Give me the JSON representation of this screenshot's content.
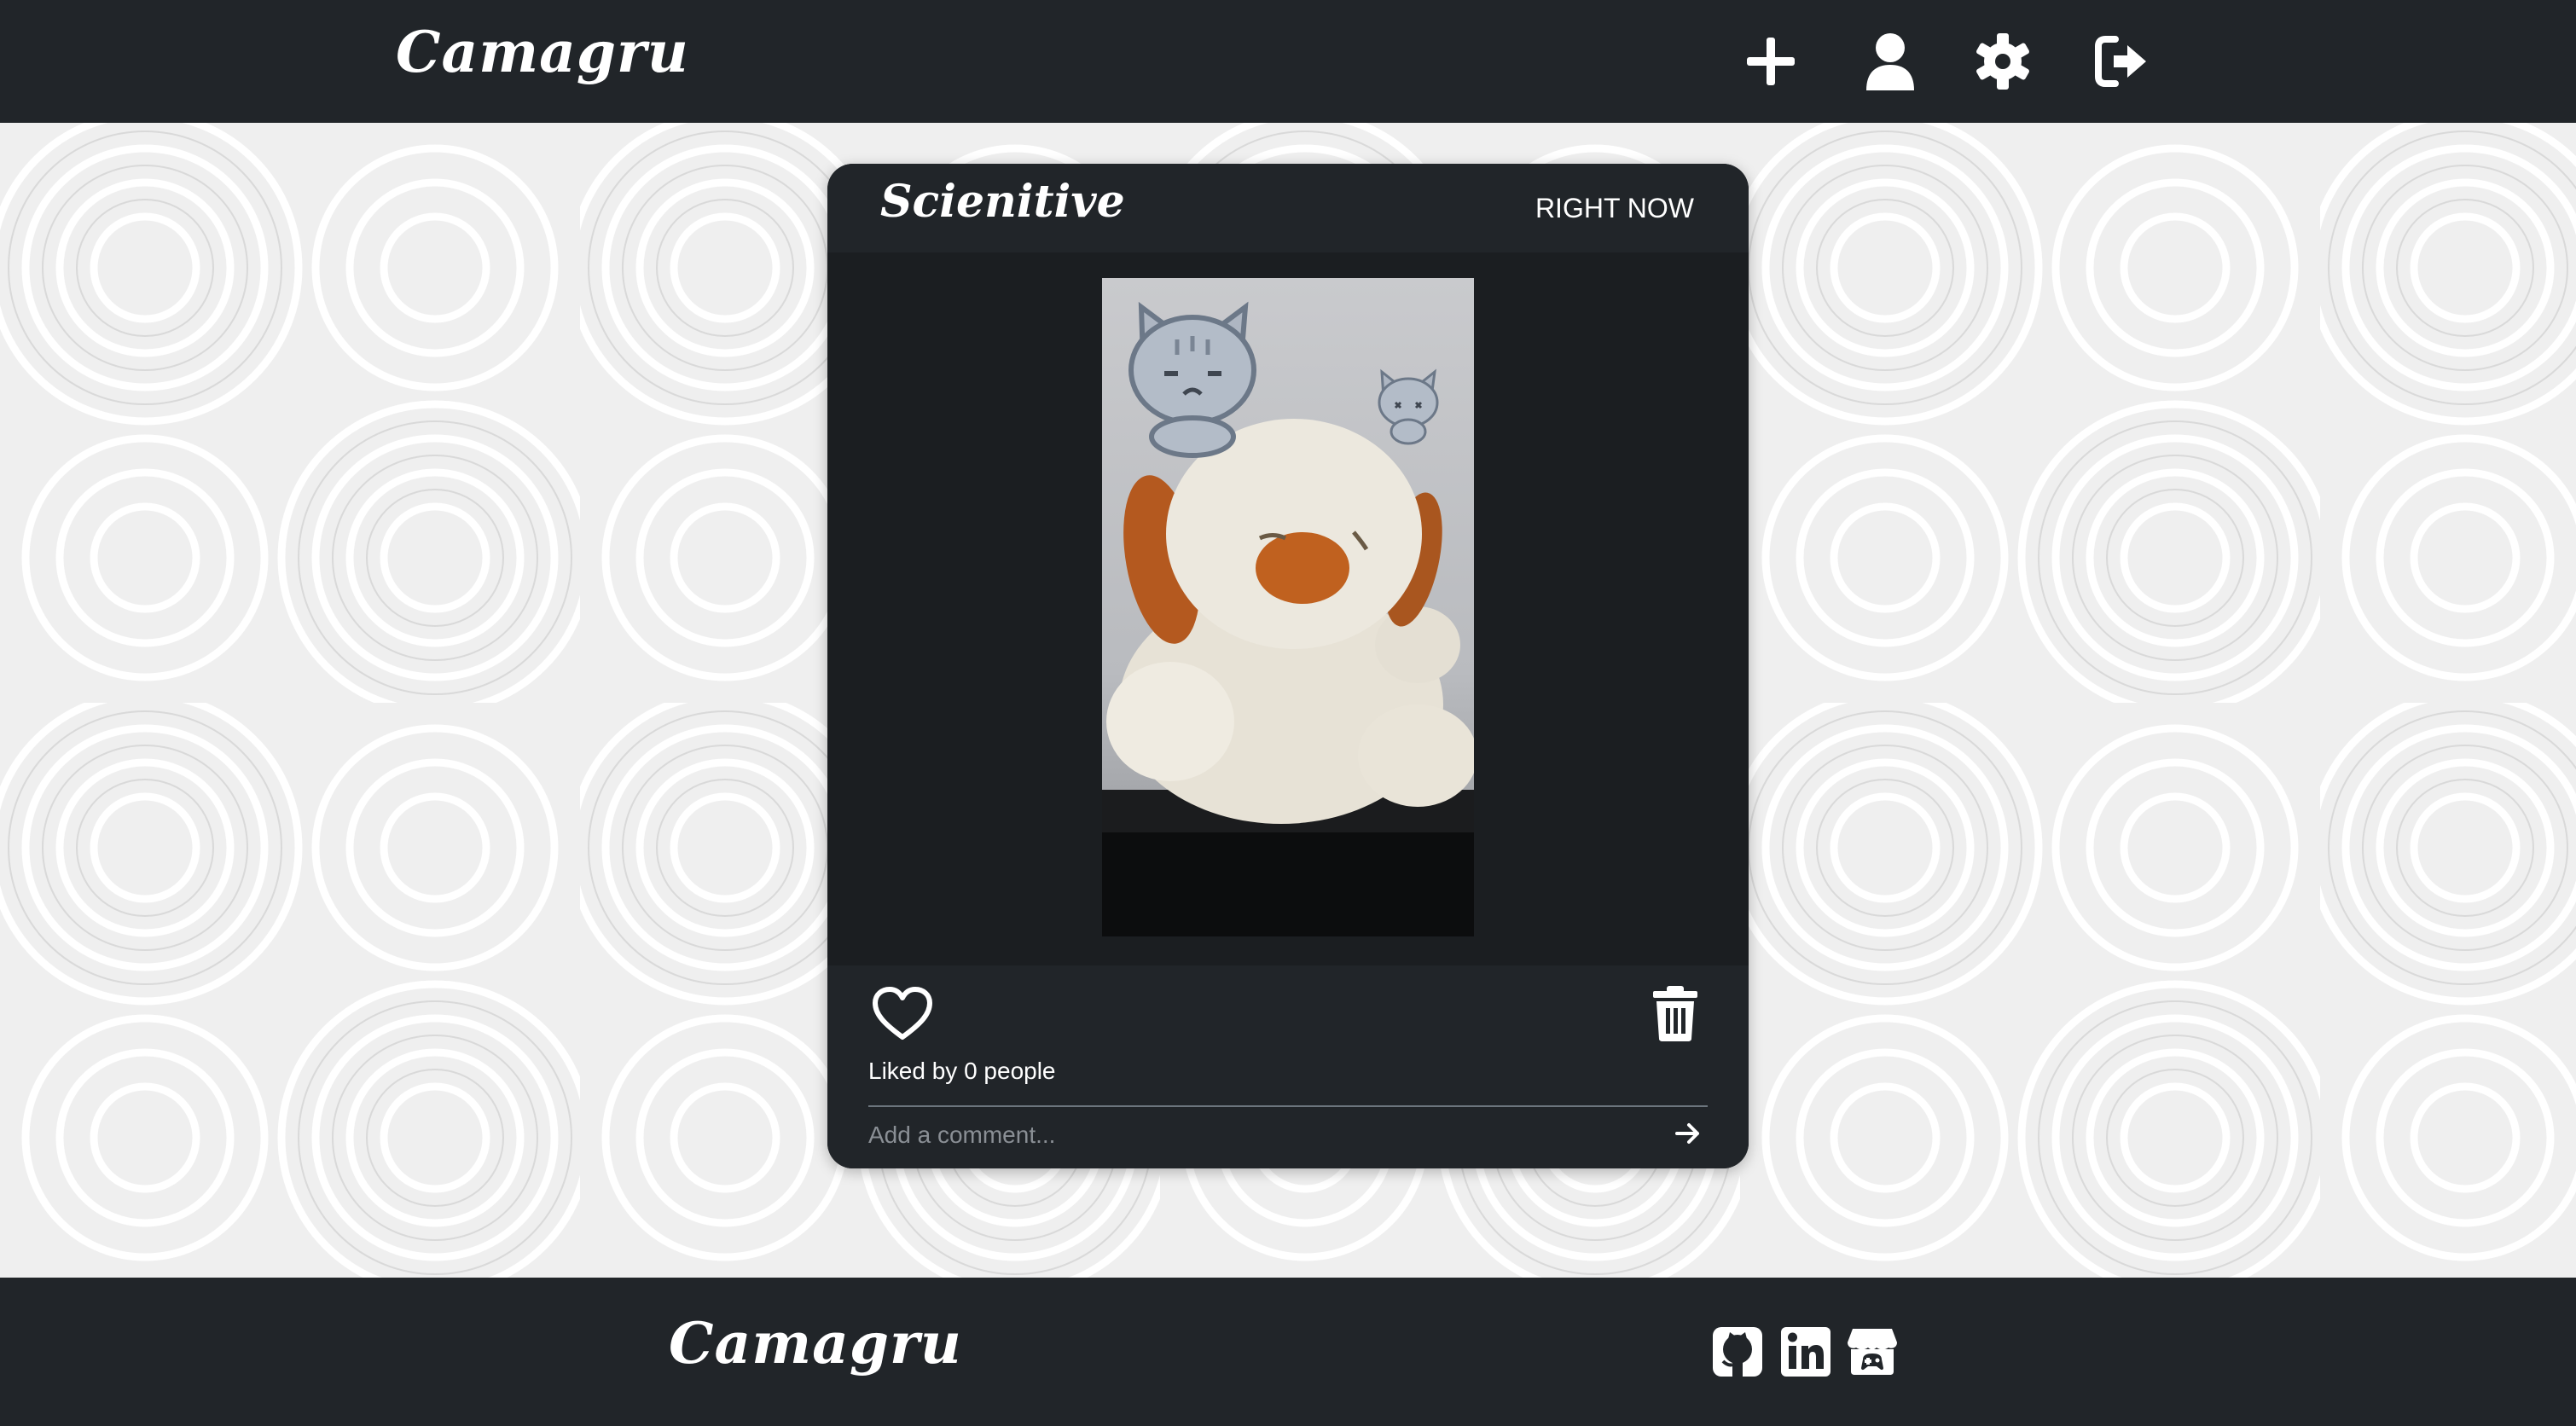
{
  "header": {
    "logo": "Camagru",
    "icons": [
      "plus-icon",
      "user-icon",
      "gear-icon",
      "logout-icon"
    ]
  },
  "post": {
    "author": "Scienitive",
    "time": "RIGHT NOW",
    "likes_text": "Liked by 0 people",
    "comment_placeholder": "Add a comment..."
  },
  "footer": {
    "logo": "Camagru",
    "social_icons": [
      "github-icon",
      "linkedin-icon",
      "itchio-icon"
    ]
  },
  "colors": {
    "bar": "#212529",
    "card": "#1b1e21",
    "background": "#efefef"
  }
}
